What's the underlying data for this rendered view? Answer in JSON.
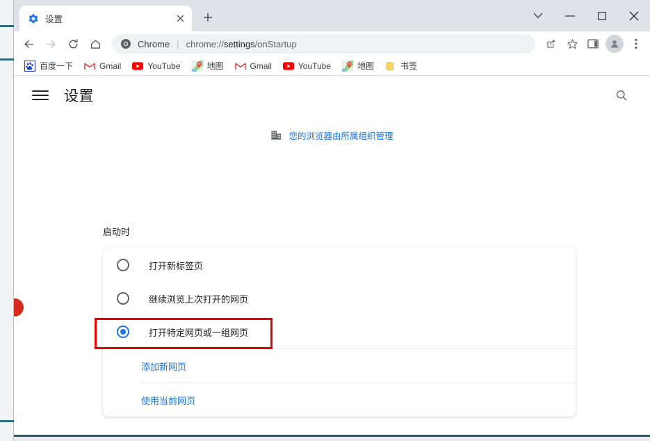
{
  "window": {
    "controls": [
      {
        "name": "dropdown-chevron",
        "icon": "chevron-down-icon",
        "label": "v"
      },
      {
        "name": "minimize",
        "icon": "minimize-icon",
        "label": "—"
      },
      {
        "name": "maximize",
        "icon": "maximize-icon",
        "label": "□"
      },
      {
        "name": "close",
        "icon": "close-icon",
        "label": "×"
      }
    ]
  },
  "tabs": [
    {
      "title": "设置",
      "favicon": "gear-icon",
      "active": true,
      "close_label": "×"
    }
  ],
  "new_tab_label": "+",
  "toolbar": {
    "back_label": "←",
    "forward_label": "→",
    "reload_label": "⟳",
    "home_label": "⌂",
    "omnibox": {
      "site_icon": "chrome-logo-icon",
      "chrome_label": "Chrome",
      "separator": "|",
      "url_prefix": "chrome://",
      "url_emphasis": "settings",
      "url_suffix": "/onStartup",
      "full_url": "chrome://settings/onStartup"
    },
    "share_label": "share-icon",
    "bookmark_label": "star-icon",
    "side_panel_label": "side-panel-icon",
    "profile_label": "avatar-icon",
    "menu_label": "⋮"
  },
  "bookmarks": [
    {
      "label": "百度一下",
      "icon": "baidu-paw-icon"
    },
    {
      "label": "Gmail",
      "icon": "gmail-icon"
    },
    {
      "label": "YouTube",
      "icon": "youtube-icon"
    },
    {
      "label": "地图",
      "icon": "maps-icon"
    },
    {
      "label": "Gmail",
      "icon": "gmail-icon"
    },
    {
      "label": "YouTube",
      "icon": "youtube-icon"
    },
    {
      "label": "地图",
      "icon": "maps-icon"
    },
    {
      "label": "书签",
      "icon": "folder-icon"
    }
  ],
  "settings": {
    "menu_icon": "hamburger-icon",
    "title": "设置",
    "search_icon": "search-icon",
    "managed_banner": {
      "icon": "building-icon",
      "text": "您的浏览器由所属组织管理"
    },
    "section_label": "启动时",
    "radio_options": [
      {
        "label": "打开新标签页",
        "checked": false
      },
      {
        "label": "继续浏览上次打开的网页",
        "checked": false
      },
      {
        "label": "打开特定网页或一组网页",
        "checked": true
      }
    ],
    "links": [
      {
        "label": "添加新网页"
      },
      {
        "label": "使用当前网页"
      }
    ]
  },
  "annotation": {
    "highlight_color": "#e60000",
    "dot_color": "#d72b1e"
  },
  "colors": {
    "accent": "#1a73e8",
    "tabstrip": "#dee1e6",
    "omnibox": "#eff1f3",
    "text": "#202124"
  }
}
